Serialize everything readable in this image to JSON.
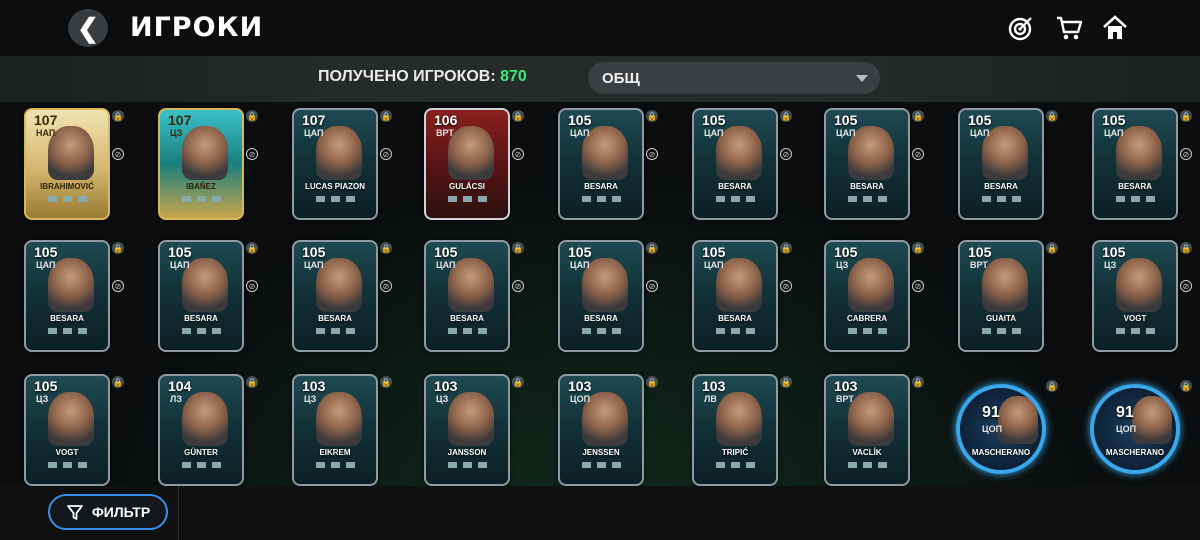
{
  "header": {
    "title": "ИГРОКИ"
  },
  "summary": {
    "count_label": "ПОЛУЧЕНО ИГРОКОВ:",
    "count_value": "870"
  },
  "sort": {
    "selected": "ОБЩ"
  },
  "footer": {
    "filter_label": "ФИЛЬТР"
  },
  "players": [
    {
      "rating": "107",
      "pos": "НАП",
      "name": "IBRAHIMOVIĆ",
      "style": "gold"
    },
    {
      "rating": "107",
      "pos": "ЦЗ",
      "name": "IBAÑEZ",
      "style": "teal-gold"
    },
    {
      "rating": "107",
      "pos": "ЦАП",
      "name": "LUCAS PIAZON",
      "style": "silver"
    },
    {
      "rating": "106",
      "pos": "ВРТ",
      "name": "GULÁCSI",
      "style": "red"
    },
    {
      "rating": "105",
      "pos": "ЦАП",
      "name": "BESARA",
      "style": "silver"
    },
    {
      "rating": "105",
      "pos": "ЦАП",
      "name": "BESARA",
      "style": "silver"
    },
    {
      "rating": "105",
      "pos": "ЦАП",
      "name": "BESARA",
      "style": "silver"
    },
    {
      "rating": "105",
      "pos": "ЦАП",
      "name": "BESARA",
      "style": "silver"
    },
    {
      "rating": "105",
      "pos": "ЦАП",
      "name": "BESARA",
      "style": "silver"
    },
    {
      "rating": "105",
      "pos": "ЦАП",
      "name": "BESARA",
      "style": "silver"
    },
    {
      "rating": "105",
      "pos": "ЦАП",
      "name": "BESARA",
      "style": "silver"
    },
    {
      "rating": "105",
      "pos": "ЦАП",
      "name": "BESARA",
      "style": "silver"
    },
    {
      "rating": "105",
      "pos": "ЦАП",
      "name": "BESARA",
      "style": "silver"
    },
    {
      "rating": "105",
      "pos": "ЦАП",
      "name": "BESARA",
      "style": "silver"
    },
    {
      "rating": "105",
      "pos": "ЦАП",
      "name": "BESARA",
      "style": "silver"
    },
    {
      "rating": "105",
      "pos": "ЦЗ",
      "name": "CABRERA",
      "style": "silver"
    },
    {
      "rating": "105",
      "pos": "ВРТ",
      "name": "GUAITA",
      "style": "silver"
    },
    {
      "rating": "105",
      "pos": "ЦЗ",
      "name": "VOGT",
      "style": "silver"
    },
    {
      "rating": "105",
      "pos": "ЦЗ",
      "name": "VOGT",
      "style": "silver"
    },
    {
      "rating": "104",
      "pos": "ЛЗ",
      "name": "GÜNTER",
      "style": "silver"
    },
    {
      "rating": "103",
      "pos": "ЦЗ",
      "name": "EIKREM",
      "style": "silver"
    },
    {
      "rating": "103",
      "pos": "ЦЗ",
      "name": "JANSSON",
      "style": "silver"
    },
    {
      "rating": "103",
      "pos": "ЦОП",
      "name": "JENSSEN",
      "style": "silver"
    },
    {
      "rating": "103",
      "pos": "ЛВ",
      "name": "TRIPIĆ",
      "style": "silver"
    },
    {
      "rating": "103",
      "pos": "ВРТ",
      "name": "VACLÍK",
      "style": "silver"
    },
    {
      "rating": "91",
      "pos": "ЦОП",
      "name": "MASCHERANO",
      "style": "round"
    },
    {
      "rating": "91",
      "pos": "ЦОП",
      "name": "MASCHERANO",
      "style": "round"
    }
  ]
}
